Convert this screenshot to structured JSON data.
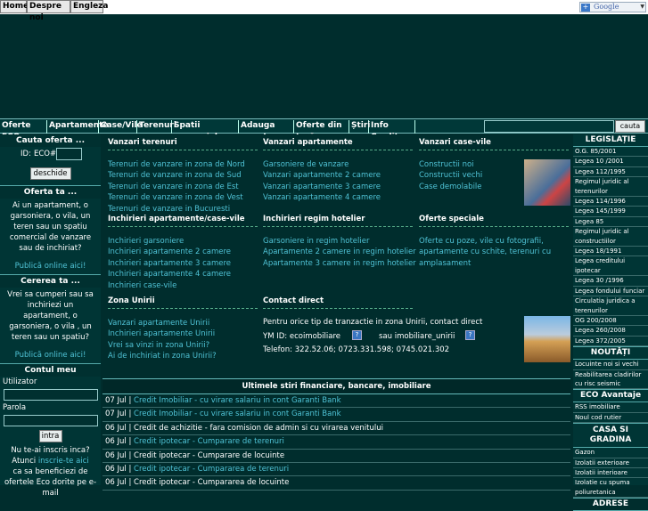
{
  "top_links": [
    "Home",
    "Despre noi",
    "Engleza"
  ],
  "google_label": "Google",
  "nav": {
    "items": [
      "Oferte ECO",
      "Apartamente",
      "Case/Vile",
      "Terenuri",
      "Spatii comerciale",
      "Adauga anunt",
      "Oferte din țară",
      "Știri",
      "Info Credite"
    ],
    "search_button": "cauta"
  },
  "left": {
    "cauta_title": "Cauta oferta ...",
    "id_label": "ID:",
    "id_value": "ECO#",
    "deschide": "deschide",
    "oferta_title": "Oferta ta ...",
    "oferta_text": "Ai un apartament, o garsoniera, o vila, un teren sau un spatiu comercial de vanzare sau de inchiriat?",
    "oferta_link": "Publică online aici!",
    "cerere_title": "Cererea ta ...",
    "cerere_text": "Vrei sa cumperi sau sa inchiriezi un apartament, o garsoniera, o vila , un teren sau un spatiu?",
    "cerere_link": "Publică online aici!",
    "cont_title": "Contul meu",
    "utilizator": "Utilizator",
    "parola": "Parola",
    "intra": "intra",
    "inscris_q": "Nu te-ai inscris inca?",
    "atunci": "Atunci",
    "inscrie_link": "inscrie-te aici",
    "beneficiezi": "ca sa beneficiezi de ofertele Eco dorite pe e-mail"
  },
  "main": {
    "sections": [
      {
        "title": "Vanzari terenuri",
        "links": [
          "Terenuri de vanzare in zona de Nord",
          "Terenuri de vanzare in zona de Sud",
          "Terenuri de vanzare in zona de Est",
          "Terenuri de vanzare in zona de Vest",
          "Terenuri de vanzare in Bucuresti"
        ]
      },
      {
        "title": "Vanzari apartamente",
        "links": [
          "Garsoniere de vanzare",
          "Vanzari apartamente 2 camere",
          "Vanzari apartamente 3 camere",
          "Vanzari apartamente 4 camere"
        ]
      },
      {
        "title": "Vanzari case-vile",
        "links": [
          "Constructii noi",
          "Constructii vechi",
          "Case demolabile"
        ]
      },
      {
        "title": "Inchirieri apartamente/case-vile",
        "links": [
          "Inchirieri garsoniere",
          "Inchirieri apartamente 2 camere",
          "Inchirieri apartamente 3 camere",
          "Inchirieri apartamente 4 camere",
          "Inchirieri case-vile"
        ]
      },
      {
        "title": "Inchirieri regim hotelier",
        "links": [
          "Garsoniere in regim hotelier",
          "Apartamente 2 camere in regim hotelier",
          "Apartamente 3 camere in regim hotelier"
        ]
      },
      {
        "title": "Oferte speciale",
        "links": [
          "Oferte cu poze, vile cu fotografii,",
          "apartamente cu schite, terenuri cu",
          "amplasament"
        ]
      },
      {
        "title": "Zona Unirii",
        "links": [
          "Vanzari apartamente Unirii",
          "Inchirieri apartamente Unirii",
          "Vrei sa vinzi in zona Unirii?",
          "Ai de inchiriat in zona Unirii?"
        ]
      }
    ],
    "contact": {
      "title": "Contact direct",
      "line1": "Pentru orice tip de tranzactie in zona Unirii, contact direct",
      "ym_label": "YM ID: ecoimobiliare",
      "ym_alt": "sau imobiliare_unirii",
      "telefon": "Telefon: 322.52.06; 0723.331.598; 0745.021.302"
    },
    "news_title": "Ultimele stiri financiare, bancare, imobiliare",
    "news": [
      {
        "date": "07 Jul |",
        "text": "Credit Imobiliar - cu virare salariu in cont Garanti Bank",
        "link": true
      },
      {
        "date": "07 Jul |",
        "text": "Credit Imobiliar - cu virare salariu in cont Garanti Bank",
        "link": true
      },
      {
        "date": "06 Jul |",
        "text": "Credit de achizitie - fara comision de admin si cu virarea venitului",
        "link": false
      },
      {
        "date": "06 Jul |",
        "text": "Credit ipotecar - Cumparare de terenuri",
        "link": true
      },
      {
        "date": "06 Jul |",
        "text": "Credit ipotecar - Cumparare de locuinte",
        "link": false
      },
      {
        "date": "06 Jul |",
        "text": "Credit ipotecar - Cumpararea de terenuri",
        "link": true
      },
      {
        "date": "06 Jul |",
        "text": "Credit ipotecar - Cumpararea de locuinte",
        "link": false
      }
    ]
  },
  "right": {
    "legislatie_title": "LEGISLAȚIE",
    "legislatie": [
      "O.G. 85/2001",
      "Legea 10 /2001",
      "Legea 112/1995",
      "Regimul juridic al terenurilor",
      "Legea 114/1996",
      "Legea 145/1999",
      "Legea 85",
      "Regimul juridic al constructiilor",
      "Legea 18/1991",
      "Legea creditului ipotecar",
      "Legea 30 /1996",
      "Legea fondului funciar",
      "Circulatia juridica a terenurilor",
      "OG 200/2008",
      "Legea 260/2008",
      "Legea 372/2005"
    ],
    "noutati_title": "NOUTĂȚI",
    "noutati": [
      "Locuinte noi si vechi",
      "Reabilitarea cladirilor cu risc seismic"
    ],
    "eco_title": "ECO Avantaje",
    "eco": [
      "RSS imobiliare",
      "Noul cod rutier"
    ],
    "casa_title": "CASA SI GRADINA",
    "casa": [
      "Gazon",
      "Izolatii exterioare",
      "Izolatii interioare",
      "Izolatie cu spuma poliuretanica"
    ],
    "adrese_title": "ADRESE"
  }
}
